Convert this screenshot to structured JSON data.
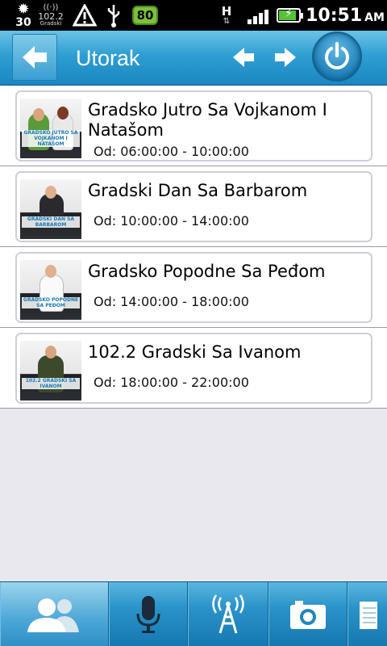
{
  "status_bar": {
    "temperature": "30",
    "radio_label": "102.2",
    "radio_sub": "Gradski",
    "battery_badge": "80",
    "network_type": "H",
    "time": "10:51",
    "ampm": "AM",
    "colors": {
      "badge": "#7dc13b",
      "battery": "#55c23a"
    }
  },
  "header": {
    "title": "Utorak",
    "back_icon": "arrow-left-icon",
    "prev_icon": "arrow-left-icon",
    "next_icon": "arrow-right-icon",
    "power_icon": "power-icon",
    "accent": "#2f9fd3"
  },
  "shows": [
    {
      "title": "Gradsko Jutro Sa Vojkanom I Natašom",
      "time": "Od: 06:00:00 - 10:00:00",
      "banner": "GRADSKO JUTRO SA VOJKANOM I NATAŠOM"
    },
    {
      "title": "Gradski Dan Sa Barbarom",
      "time": "Od: 10:00:00 - 14:00:00",
      "banner": "GRADSKI DAN SA BARBAROM"
    },
    {
      "title": "Gradsko Popodne Sa Peđom",
      "time": "Od: 14:00:00 - 18:00:00",
      "banner": "GRADSKO POPODNE SA PEĐOM"
    },
    {
      "title": "102.2 Gradski Sa Ivanom",
      "time": "Od: 18:00:00 - 22:00:00",
      "banner": "102.2 GRADSKI SA IVANOM"
    }
  ],
  "toolbar": {
    "items": [
      "people-icon",
      "microphone-icon",
      "antenna-icon",
      "camera-icon",
      "notepad-icon"
    ]
  }
}
